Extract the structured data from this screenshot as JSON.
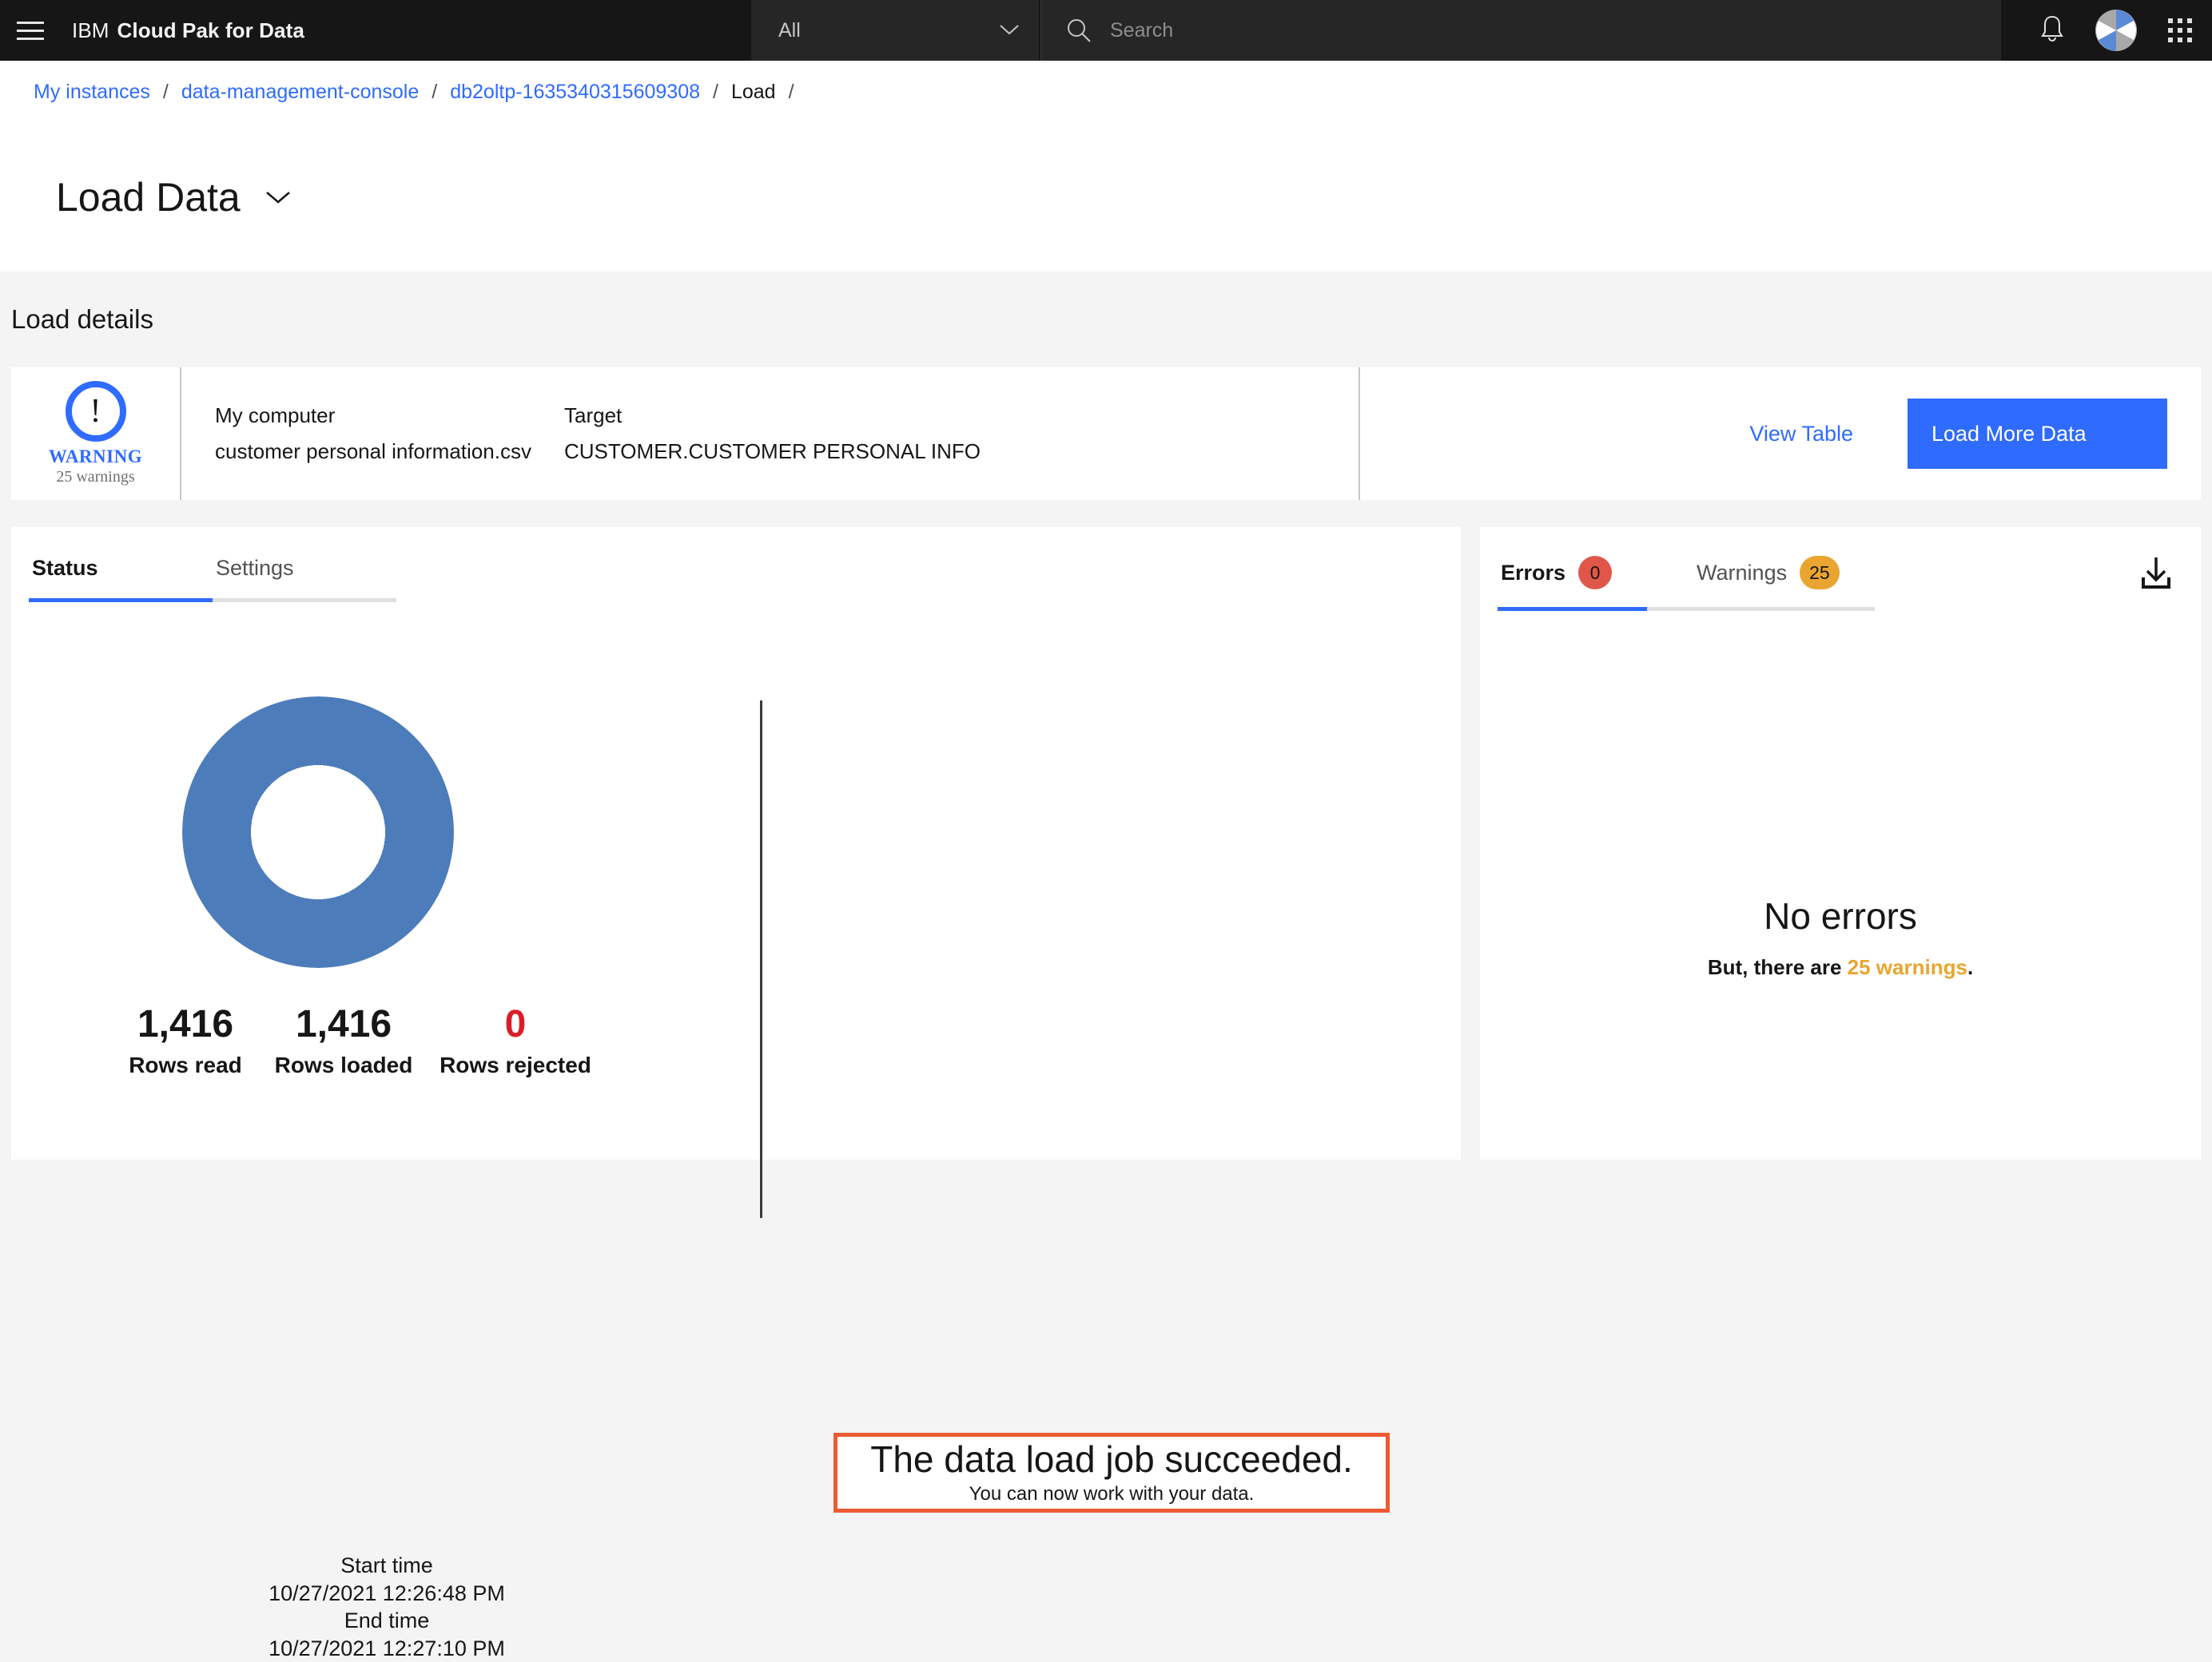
{
  "header": {
    "menu_icon": "hamburger-icon",
    "brand_prefix": "IBM",
    "brand_name": "Cloud Pak for Data",
    "scope_value": "All",
    "scope_chevron": "chevron-down-icon",
    "search_placeholder": "Search",
    "search_value": "",
    "search_icon": "search-icon",
    "notifications_icon": "bell-icon",
    "avatar": "user-avatar",
    "app_switcher_icon": "grid-icon"
  },
  "breadcrumb": {
    "items": [
      {
        "label": "My instances",
        "link": true
      },
      {
        "label": "data-management-console",
        "link": true
      },
      {
        "label": "db2oltp-1635340315609308",
        "link": true
      },
      {
        "label": "Load",
        "link": false
      }
    ],
    "separator": "/",
    "trailing_separator": "/"
  },
  "page": {
    "title": "Load Data",
    "title_chevron": "chevron-down-icon",
    "section_heading": "Load details"
  },
  "summary": {
    "status_icon": "warning-exclamation-icon",
    "status_label": "WARNING",
    "status_count": "25 warnings",
    "source_label": "My computer",
    "source_value": "customer  personal  information.csv",
    "target_label": "Target",
    "target_value": "CUSTOMER.CUSTOMER  PERSONAL  INFO",
    "view_table_label": "View Table",
    "load_more_label": "Load More Data"
  },
  "status_panel": {
    "tabs": [
      {
        "label": "Status",
        "active": true
      },
      {
        "label": "Settings",
        "active": false
      }
    ],
    "stats": [
      {
        "value": "1,416",
        "label": "Rows read",
        "color": "#161616"
      },
      {
        "value": "1,416",
        "label": "Rows loaded",
        "color": "#161616"
      },
      {
        "value": "0",
        "label": "Rows rejected",
        "color": "#da1e28"
      }
    ],
    "start_time_label": "Start time",
    "start_time_value": "10/27/2021 12:26:48 PM",
    "end_time_label": "End time",
    "end_time_value": "10/27/2021 12:27:10 PM",
    "success_title": "The data load job succeeded.",
    "success_subtitle": "You can now work with your data."
  },
  "errors_panel": {
    "tabs": [
      {
        "label": "Errors",
        "badge": "0",
        "badge_kind": "err",
        "active": true
      },
      {
        "label": "Warnings",
        "badge": "25",
        "badge_kind": "warn",
        "active": false
      }
    ],
    "download_icon": "download-icon",
    "empty_heading": "No errors",
    "empty_sub_prefix": "But, there are ",
    "empty_sub_highlight": "25 warnings",
    "empty_sub_suffix": "."
  },
  "chart_data": {
    "type": "pie",
    "title": "Rows loaded vs rejected",
    "labels": [
      "Rows loaded",
      "Rows rejected"
    ],
    "values": [
      1416,
      0
    ],
    "colors": [
      "#4d7cba",
      "#da1e28"
    ],
    "donut": true,
    "inner_radius_ratio": 0.49,
    "legend": "below",
    "annotations": [
      "1,416 Rows read",
      "1,416 Rows loaded",
      "0 Rows rejected"
    ]
  },
  "colors": {
    "brand_blue": "#2f6bff",
    "donut_blue": "#4d7cba",
    "error_red": "#da1e28",
    "badge_red": "#e0574a",
    "warning_amber": "#eaa530",
    "success_border": "#eb5b32",
    "header_black": "#161616",
    "page_bg": "#f4f4f4"
  }
}
